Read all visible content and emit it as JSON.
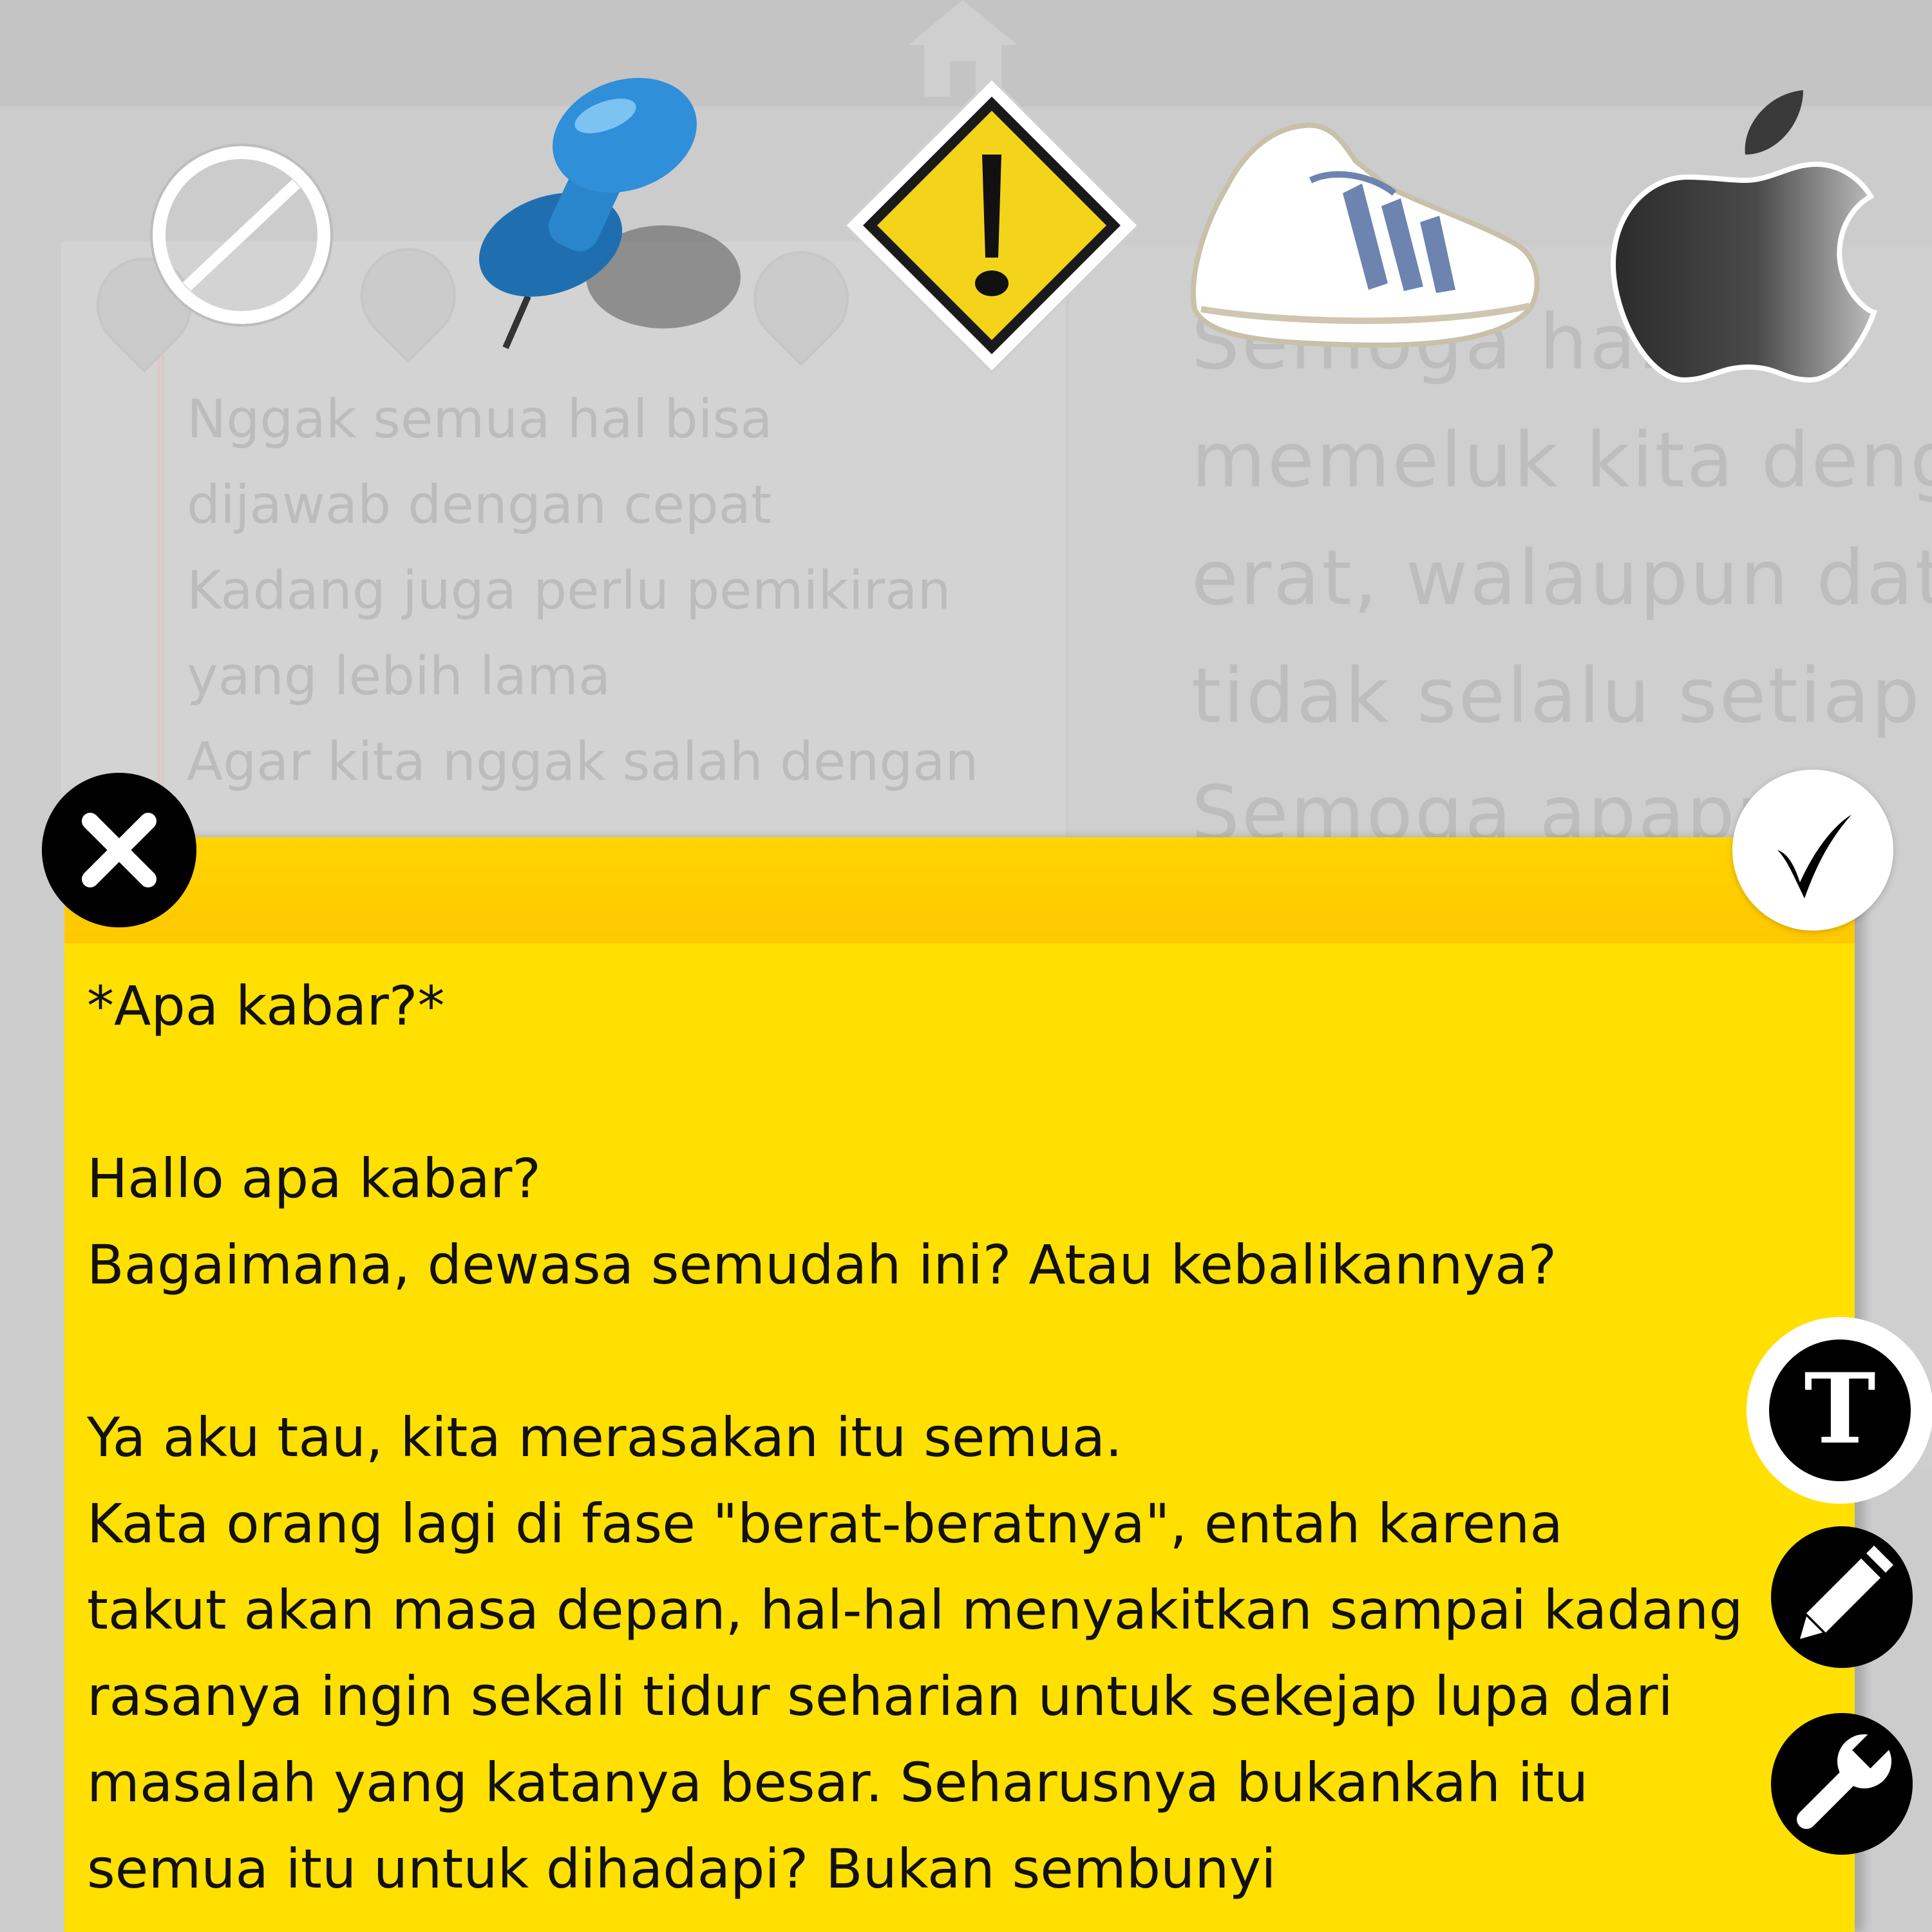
{
  "background_notes": {
    "left_text": "Nggak semua hal bisa\ndijawab dengan cepat\nKadang juga perlu pemikiran\nyang lebih lama\nAgar kita nggak salah dengan",
    "right_text": "Semoga hal... se\nmemeluk kita deng\nerat, walaupun dat\ntidak selalu setiap\nSemoga apapu"
  },
  "stickers": {
    "no_sign": "no-sign-icon",
    "push_pin": "push-pin-icon",
    "warning": "warning-sign-icon",
    "sneaker": "sneaker-icon",
    "apple": "apple-logo-icon"
  },
  "note": {
    "content": "*Apa kabar?*\n\nHallo apa kabar?\nBagaimana, dewasa semudah ini? Atau kebalikannya?\n\nYa aku tau, kita merasakan itu semua.\nKata orang lagi di fase \"berat-beratnya\", entah karena\ntakut akan masa depan, hal-hal menyakitkan sampai kadang\nrasanya ingin sekali tidur seharian untuk sekejap lupa dari\nmasalah yang katanya besar. Seharusnya bukankah itu\nsemua itu untuk dihadapi? Bukan sembunyi"
  },
  "toolbar": {
    "text_button_glyph": "T"
  },
  "colors": {
    "note_yellow": "#ffe000",
    "header_yellow": "#ffd400",
    "button_black": "#000000"
  }
}
